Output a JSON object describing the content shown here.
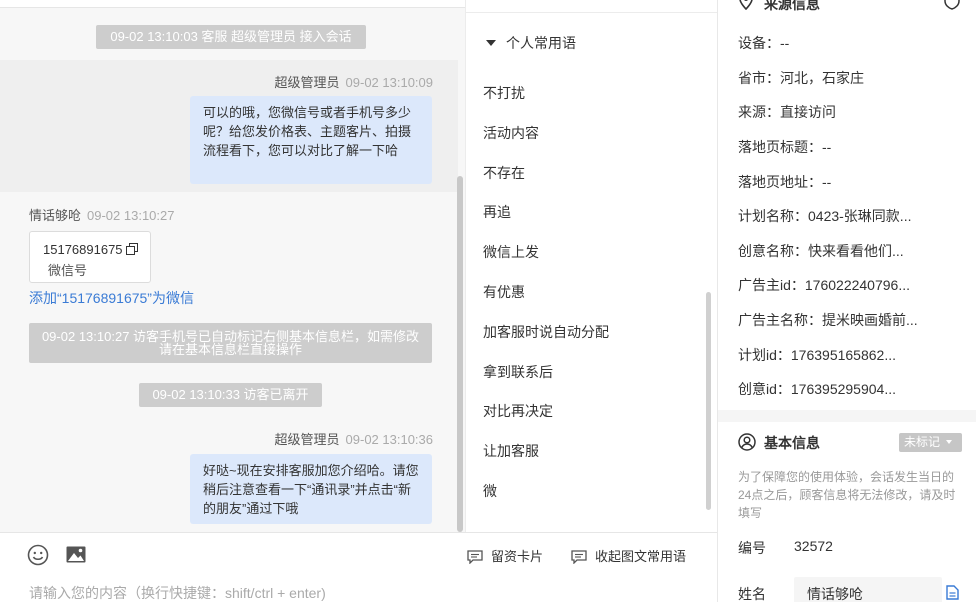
{
  "chat": {
    "system_notes": [
      "09-02 13:10:03 客服 超级管理员 接入会话",
      "09-02 13:10:27 访客手机号已自动标记右侧基本信息栏，如需修改请在基本信息栏直接操作",
      "09-02 13:10:33 访客已离开"
    ],
    "messages": [
      {
        "sender": "超级管理员",
        "time": "09-02 13:10:09",
        "text": "可以的哦，您微信号或者手机号多少呢？给您发价格表、主题客片、拍摄流程看下，您可以对比了解一下哈"
      },
      {
        "sender": "情话够呛",
        "time": "09-02 13:10:27"
      },
      {
        "sender": "超级管理员",
        "time": "09-02 13:10:36",
        "text": "好哒~现在安排客服加您介绍哈。请您稍后注意查看一下“通讯录”并点击“新的朋友”通过下哦"
      }
    ],
    "card": {
      "number": "15176891675",
      "label": "微信号",
      "copy_icon": "copy-icon"
    },
    "add_wechat_link": "添加“15176891675”为微信"
  },
  "phrases": {
    "header": "个人常用语",
    "items": [
      "不打扰",
      "活动内容",
      "不存在",
      "再追",
      "微信上发",
      "有优惠",
      "加客服时说自动分配",
      "拿到联系后",
      "对比再决定",
      "让加客服",
      "微"
    ]
  },
  "info": {
    "source_title": "来源信息",
    "source_rows": [
      "设备：--",
      "省市：河北，石家庄",
      "来源：直接访问",
      "落地页标题：--",
      "落地页地址：--",
      "计划名称：0423-张琳同款...",
      "创意名称：快来看看他们...",
      "广告主id：176022240796...",
      "广告主名称：提米映画婚前...",
      "计划id：176395165862...",
      "创意id：176395295904..."
    ],
    "basic_title": "基本信息",
    "mark_status": "未标记",
    "notice": "为了保障您的使用体验，会话发生当日的24点之后，顾客信息将无法修改，请及时填写",
    "id_label": "编号",
    "id_value": "32572",
    "name_label": "姓名",
    "name_value": "情话够呛"
  },
  "toolbar": {
    "emoji_icon": "emoji-icon",
    "image_icon": "image-icon",
    "resume_card_label": "留资卡片",
    "collapse_phrases_label": "收起图文常用语",
    "input_placeholder": "请输入您的内容（换行快捷键：shift/ctrl + enter)"
  },
  "colors": {
    "bubble": "#dce8fb",
    "system_note": "#cdcdcd",
    "link": "#3a7bd5",
    "chat_bg": "#f7f7f7"
  }
}
